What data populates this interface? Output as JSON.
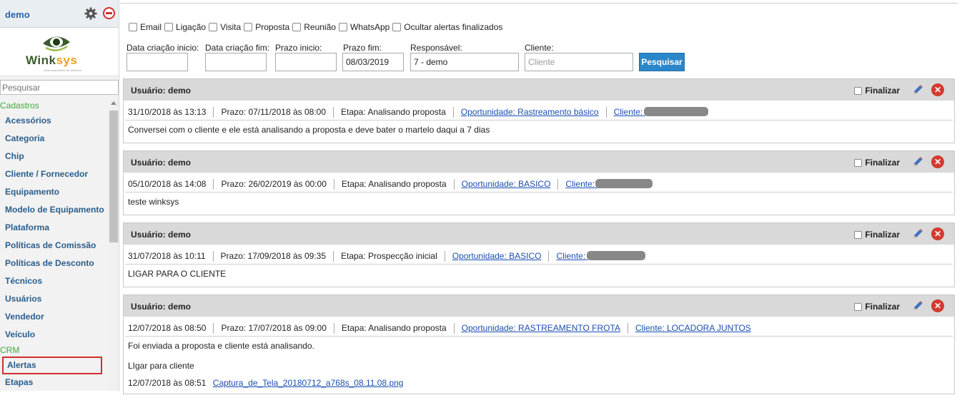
{
  "sidebar": {
    "user": "demo",
    "logo_text_a": "Wink",
    "logo_text_b": "sys",
    "logo_sub": "Desenvolvimento de Software",
    "search_placeholder": "Pesquisar",
    "section_cadastros": "Cadastros",
    "cadastros": [
      "Acessórios",
      "Categoria",
      "Chip",
      "Cliente / Fornecedor",
      "Equipamento",
      "Modelo de Equipamento",
      "Plataforma",
      "Políticas de Comissão",
      "Políticas de Desconto",
      "Técnicos",
      "Usuários",
      "Vendedor",
      "Veículo"
    ],
    "section_crm": "CRM",
    "crm": [
      "Alertas",
      "Etapas"
    ]
  },
  "filters": {
    "checkboxes": [
      "Email",
      "Ligação",
      "Visita",
      "Proposta",
      "Reunião",
      "WhatsApp",
      "Ocultar alertas finalizados"
    ],
    "labels": {
      "data_criacao_inicio": "Data criação inicio:",
      "data_criacao_fim": "Data criação fim:",
      "prazo_inicio": "Prazo inicio:",
      "prazo_fim": "Prazo fim:",
      "responsavel": "Responsável:",
      "cliente": "Cliente:"
    },
    "values": {
      "data_criacao_inicio": "",
      "data_criacao_fim": "",
      "prazo_inicio": "",
      "prazo_fim": "08/03/2019",
      "responsavel": "7 - demo",
      "cliente": ""
    },
    "cliente_placeholder": "Cliente",
    "search_button": "Pesquisar"
  },
  "alerts": [
    {
      "user": "Usuário: demo",
      "finalizar": "Finalizar",
      "date": "31/10/2018 às 13:13",
      "prazo": "Prazo: 07/11/2018 às 08:00",
      "etapa": "Etapa: Analisando proposta",
      "oportunidade": "Oportunidade: Rastreamento básico",
      "cliente": "Cliente:",
      "text": "Conversei com o cliente e ele está analisando a proposta e deve bater o martelo daqui a 7 dias"
    },
    {
      "user": "Usuário: demo",
      "finalizar": "Finalizar",
      "date": "05/10/2018 às 14:08",
      "prazo": "Prazo: 26/02/2019 às 00:00",
      "etapa": "Etapa: Analisando proposta",
      "oportunidade": "Oportunidade: BASICO",
      "cliente": "Cliente:",
      "text": "teste winksys"
    },
    {
      "user": "Usuário: demo",
      "finalizar": "Finalizar",
      "date": "31/07/2018 às 10:11",
      "prazo": "Prazo: 17/09/2018 às 09:35",
      "etapa": "Etapa: Prospecção inicial",
      "oportunidade": "Oportunidade: BASICO",
      "cliente": "Cliente:",
      "text": "LIGAR PARA O CLIENTE"
    },
    {
      "user": "Usuário: demo",
      "finalizar": "Finalizar",
      "date": "12/07/2018 às 08:50",
      "prazo": "Prazo: 17/07/2018 às 09:00",
      "etapa": "Etapa: Analisando proposta",
      "oportunidade": "Oportunidade: RASTREAMENTO FROTA",
      "cliente": "Cliente: LOCADORA JUNTOS",
      "text": "Foi enviada a proposta e cliente está analisando.",
      "text2": "LIgar para cliente",
      "attachment_date": "12/07/2018 às 08:51",
      "attachment_name": "Captura_de_Tela_20180712_a768s_08.11.08.png"
    }
  ]
}
